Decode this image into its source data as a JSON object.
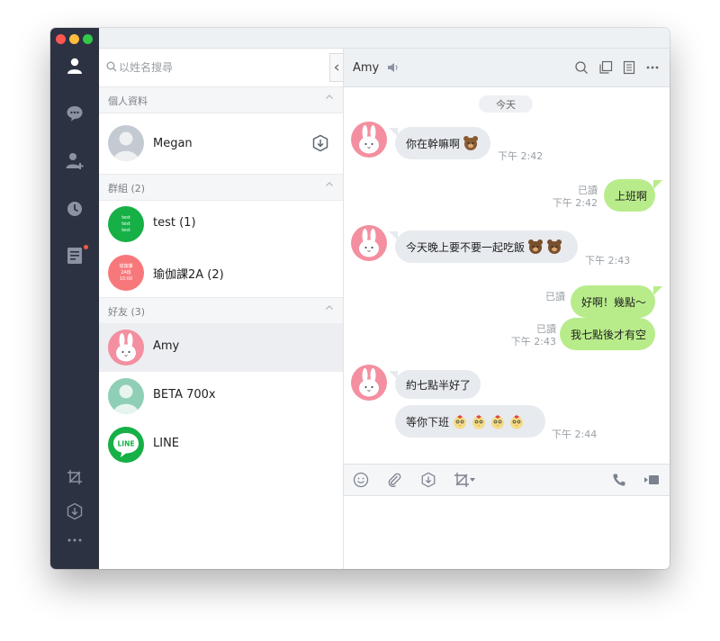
{
  "window": {
    "traffic_colors": [
      "#fc5753",
      "#fdbc40",
      "#33c748"
    ]
  },
  "rail": {
    "items": [
      {
        "icon": "person-icon",
        "active": true
      },
      {
        "icon": "chat-icon",
        "active": false
      },
      {
        "icon": "add-friend-icon",
        "active": false
      },
      {
        "icon": "clock-icon",
        "active": false
      },
      {
        "icon": "note-icon",
        "active": false,
        "badge": true
      }
    ],
    "bottom_items": [
      {
        "icon": "crop-icon"
      },
      {
        "icon": "download-icon"
      },
      {
        "icon": "more-icon"
      }
    ]
  },
  "contacts": {
    "search_placeholder": "以姓名搜尋",
    "sections": {
      "profile": {
        "label": "個人資料"
      },
      "groups": {
        "label": "群組 (2)"
      },
      "friends": {
        "label": "好友 (3)"
      }
    },
    "profile": {
      "name": "Megan"
    },
    "groups": [
      {
        "name": "test (1)",
        "avatar_color": "#16b046",
        "avatar_lines": [
          "test",
          "test",
          "test"
        ]
      },
      {
        "name": "瑜伽課2A (2)",
        "avatar_color": "#f7787b",
        "avatar_lines": [
          "瑜伽課",
          "2A班",
          "10:00"
        ]
      }
    ],
    "friends": [
      {
        "name": "Amy",
        "selected": true,
        "avatar": "cony-bunny"
      },
      {
        "name": "BETA 700x",
        "selected": false,
        "avatar": "default-person"
      },
      {
        "name": "LINE",
        "selected": false,
        "avatar": "line-logo"
      }
    ]
  },
  "chat": {
    "title": "Amy",
    "date_separator": "今天",
    "messages": {
      "m1": {
        "text": "你在幹嘛啊",
        "time": "下午 2:42"
      },
      "m2": {
        "text": "上班啊",
        "read": "已讀",
        "time": "下午 2:42"
      },
      "m3": {
        "text": "今天晚上要不要一起吃飯",
        "time": "下午 2:43"
      },
      "m4": {
        "text": "好啊！幾點～",
        "read": "已讀"
      },
      "m5": {
        "text": "我七點後才有空",
        "read": "已讀",
        "time": "下午 2:43"
      },
      "m6": {
        "text": "約七點半好了"
      },
      "m7": {
        "text": "等你下班",
        "time": "下午 2:44"
      }
    }
  },
  "colors": {
    "rail_bg": "#2c3241",
    "outgoing_bubble": "#b8ec8a",
    "incoming_bubble": "#e7eaef",
    "line_green": "#16b046"
  }
}
